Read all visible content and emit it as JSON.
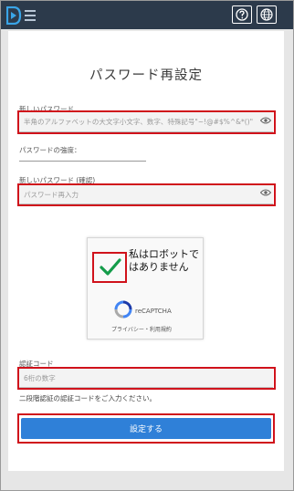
{
  "title": "パスワード再設定",
  "new_password": {
    "label": "新しいパスワード",
    "placeholder": "半角のアルファベットの大文字小文字、数字、特殊記号\"~!@#$%^&*()\""
  },
  "strength": {
    "label": "パスワードの強度："
  },
  "confirm_password": {
    "label": "新しいパスワード (確認)",
    "placeholder": "パスワード再入力"
  },
  "captcha": {
    "text": "私はロボットではありません",
    "brand": "reCAPTCHA",
    "privacy": "プライバシー・利用規約",
    "checked": true
  },
  "auth_code": {
    "label": "認証コード",
    "placeholder": "6桁の数字",
    "hint": "二段階認証の認証コードをご入力ください。"
  },
  "submit_label": "設定する",
  "colors": {
    "accent": "#2f80d8",
    "highlight": "#d0121b",
    "topbar": "#2c3a4b",
    "check": "#149c4a"
  },
  "icons": {
    "logo": "app-logo-icon",
    "help": "help-icon",
    "language": "globe-icon",
    "eye": "eye-icon",
    "recaptcha": "recaptcha-icon"
  }
}
